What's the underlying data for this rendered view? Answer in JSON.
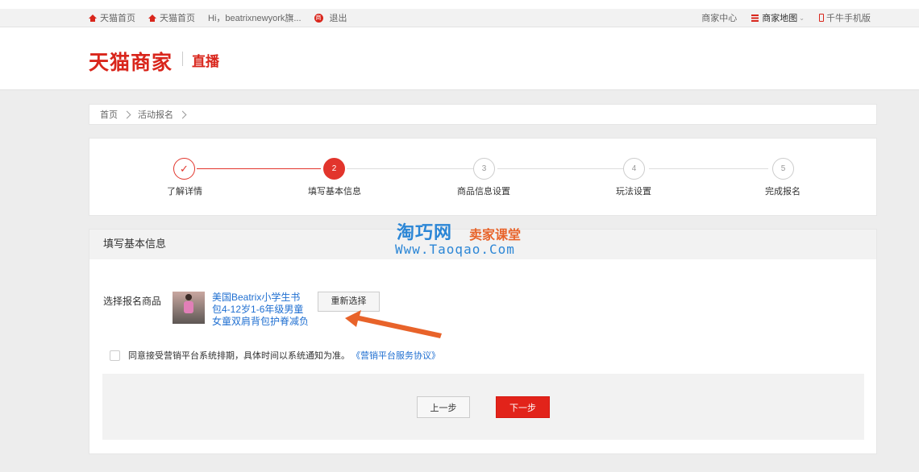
{
  "topbar": {
    "home1": "天猫首页",
    "home2": "天猫首页",
    "greeting": "Hi，beatrixnewyork旗...",
    "logout_badge": "商",
    "logout": "退出",
    "merchant_center": "商家中心",
    "merchant_map": "商家地图",
    "mobile": "千牛手机版"
  },
  "header": {
    "logo": "天猫商家",
    "section": "直播"
  },
  "breadcrumb": [
    "首页",
    "活动报名"
  ],
  "steps": [
    {
      "num": "✓",
      "label": "了解详情",
      "state": "done"
    },
    {
      "num": "2",
      "label": "填写基本信息",
      "state": "active"
    },
    {
      "num": "3",
      "label": "商品信息设置",
      "state": "todo"
    },
    {
      "num": "4",
      "label": "玩法设置",
      "state": "todo"
    },
    {
      "num": "5",
      "label": "完成报名",
      "state": "todo"
    }
  ],
  "form": {
    "title": "填写基本信息",
    "product_label": "选择报名商品",
    "product_name": "美国Beatrix小学生书包4-12岁1-6年级男童女童双肩背包护脊减负",
    "reselect": "重新选择",
    "agree_text": "同意接受营销平台系统排期，具体时间以系统通知为准。",
    "agree_link": "《营销平台服务协议》",
    "prev": "上一步",
    "next": "下一步"
  },
  "watermark": {
    "brand": "淘巧网",
    "sub": "卖家课堂",
    "url": "Www.Taoqao.Com"
  },
  "colors": {
    "accent": "#e2352c",
    "link": "#1f6fd1"
  }
}
